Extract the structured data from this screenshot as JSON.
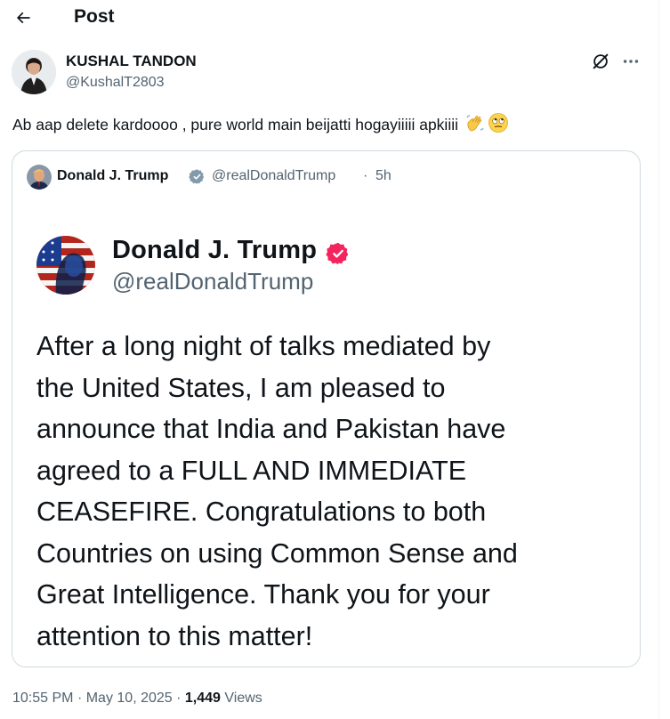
{
  "header": {
    "title": "Post",
    "back_icon": "arrow-left-icon"
  },
  "author": {
    "name": "KUSHAL TANDON",
    "handle": "@KushalT2803"
  },
  "post": {
    "text": "Ab aap delete kardoooo , pure world main beijatti hogayiiiii apkiiii",
    "emojis": [
      "waving-hand-emoji",
      "eye-roll-emoji"
    ]
  },
  "quote": {
    "name": "Donald J. Trump",
    "handle": "@realDonaldTrump",
    "separator": "·",
    "time": "5h",
    "image": {
      "name": "Donald J. Trump",
      "handle": "@realDonaldTrump",
      "body_lines": [
        "After a long night of talks mediated by",
        "the United States, I am pleased to",
        "announce that India and Pakistan have",
        "agreed to a FULL AND IMMEDIATE",
        "CEASEFIRE. Congratulations to both",
        "Countries on using Common Sense and",
        "Great Intelligence. Thank you for your",
        "attention to this matter!"
      ]
    }
  },
  "meta": {
    "time": "10:55 PM",
    "sep1": "·",
    "date": "May 10, 2025",
    "sep2": "·",
    "views_count": "1,449",
    "views_label": "Views"
  },
  "colors": {
    "text_primary": "#0f1419",
    "text_secondary": "#536471",
    "border": "#cfd9de",
    "verified_blue": "#829aab",
    "verified_pink": "#f4245e"
  }
}
